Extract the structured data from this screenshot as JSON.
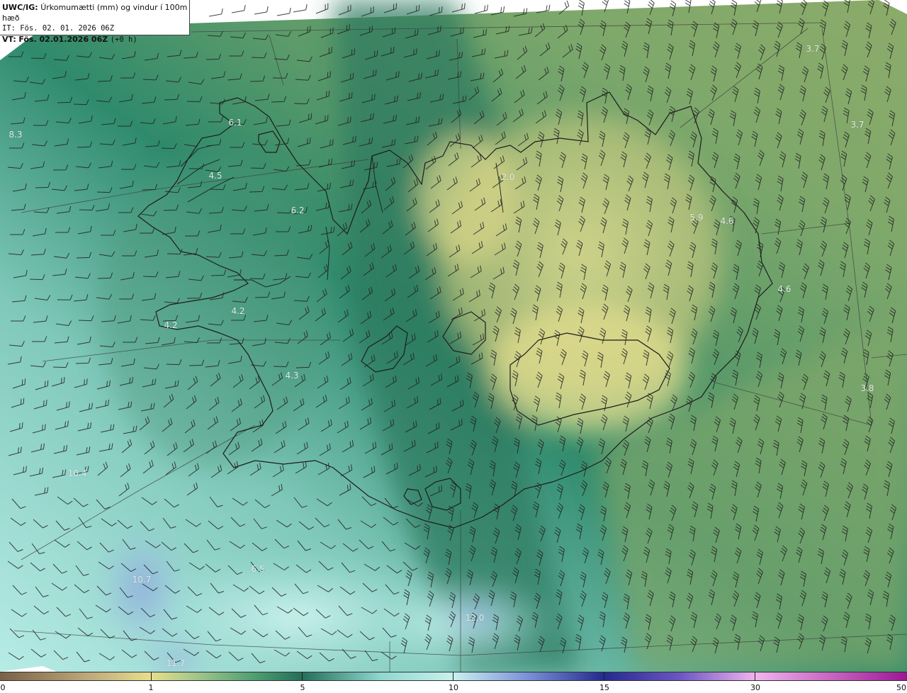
{
  "header": {
    "model_code": "UWC/IG:",
    "field_title": "Úrkomumætti (mm) og vindur í 100m hæð",
    "init_time": "IT: Fös. 02. 01. 2026 06Z",
    "valid_label": "VT:",
    "valid_time": "Fös. 02.01.2026 06Z",
    "lead_time": "(+0 h)"
  },
  "map": {
    "value_labels": [
      "3.7",
      "3.7",
      "8.3",
      "4.5",
      "4.2",
      "4.2",
      "4.3",
      "2.0",
      "4.6",
      "4.6",
      "3.8",
      "10.4",
      "6.5",
      "10.7",
      "12.0",
      "11.7",
      "6.1",
      "6.2",
      "5.9"
    ]
  },
  "colorbar": {
    "ticks": [
      "0",
      "1",
      "5",
      "10",
      "15",
      "30",
      "50"
    ],
    "colors": {
      "dry": "#7a6048",
      "tan": "#b9a377",
      "yellow": "#e6df8e",
      "green_light": "#9cc48a",
      "green": "#4f9f72",
      "teal": "#256e5a",
      "cyan": "#8fd7cf",
      "cyan_light": "#c9f1ee",
      "blue": "#7c93d8",
      "navy": "#232a8e",
      "purple": "#6d56c4",
      "pink": "#f0b4ec",
      "magenta": "#9e1695"
    }
  }
}
